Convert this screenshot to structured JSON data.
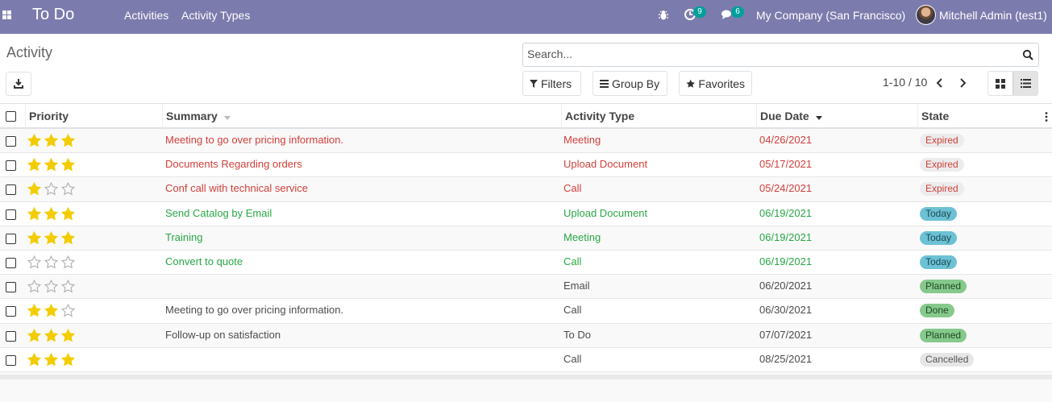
{
  "nav": {
    "app_title": "To Do",
    "menu": [
      "Activities",
      "Activity Types"
    ],
    "activity_count": "9",
    "message_count": "6",
    "company": "My Company (San Francisco)",
    "user": "Mitchell Admin (test1)"
  },
  "control": {
    "title": "Activity",
    "search_placeholder": "Search...",
    "filters_label": "Filters",
    "groupby_label": "Group By",
    "favorites_label": "Favorites",
    "pager": "1-10 / 10"
  },
  "columns": {
    "priority": "Priority",
    "summary": "Summary",
    "activity_type": "Activity Type",
    "due_date": "Due Date",
    "state": "State"
  },
  "rows": [
    {
      "stars": 3,
      "summary": "Meeting to go over pricing information.",
      "type": "Meeting",
      "due": "04/26/2021",
      "state": "Expired",
      "tone": "red"
    },
    {
      "stars": 3,
      "summary": "Documents Regarding orders",
      "type": "Upload Document",
      "due": "05/17/2021",
      "state": "Expired",
      "tone": "red"
    },
    {
      "stars": 1,
      "summary": "Conf call with technical service",
      "type": "Call",
      "due": "05/24/2021",
      "state": "Expired",
      "tone": "red"
    },
    {
      "stars": 3,
      "summary": "Send Catalog by Email",
      "type": "Upload Document",
      "due": "06/19/2021",
      "state": "Today",
      "tone": "green"
    },
    {
      "stars": 3,
      "summary": "Training",
      "type": "Meeting",
      "due": "06/19/2021",
      "state": "Today",
      "tone": "green"
    },
    {
      "stars": 0,
      "summary": "Convert to quote",
      "type": "Call",
      "due": "06/19/2021",
      "state": "Today",
      "tone": "green"
    },
    {
      "stars": 0,
      "summary": "",
      "type": "Email",
      "due": "06/20/2021",
      "state": "Planned",
      "tone": "dark"
    },
    {
      "stars": 2,
      "summary": "Meeting to go over pricing information.",
      "type": "Call",
      "due": "06/30/2021",
      "state": "Done",
      "tone": "dark"
    },
    {
      "stars": 3,
      "summary": "Follow-up on satisfaction",
      "type": "To Do",
      "due": "07/07/2021",
      "state": "Planned",
      "tone": "dark"
    },
    {
      "stars": 3,
      "summary": "",
      "type": "Call",
      "due": "08/25/2021",
      "state": "Cancelled",
      "tone": "dark"
    }
  ],
  "state_colors": {
    "Expired": {
      "bg": "#ececec",
      "fg": "#d23f3a"
    },
    "Today": {
      "bg": "#6cc1d4",
      "fg": "#1d4a55"
    },
    "Planned": {
      "bg": "#86c98c",
      "fg": "#1f4a24"
    },
    "Done": {
      "bg": "#86c98c",
      "fg": "#1f4a24"
    },
    "Cancelled": {
      "bg": "#e6e6e6",
      "fg": "#555555"
    }
  },
  "colors": {
    "navbar": "#7c7bad",
    "star_filled": "#f3cc00",
    "star_empty": "#b0b0b0"
  }
}
